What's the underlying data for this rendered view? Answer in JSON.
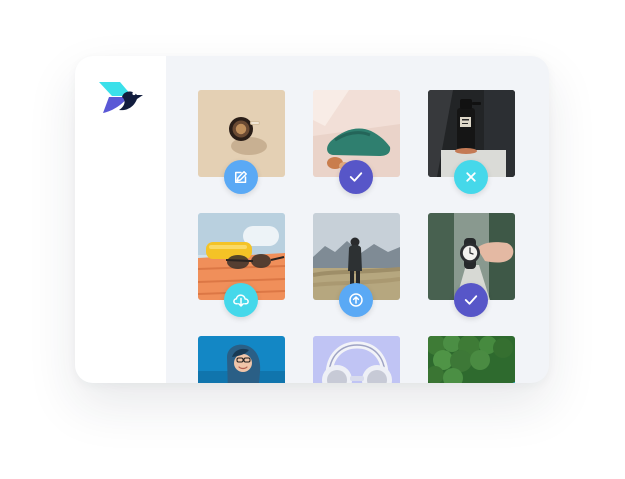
{
  "app": {
    "name": "",
    "logo_icon": "bird-logo-icon"
  },
  "colors": {
    "card_background": "#f2f4f8",
    "sidebar_background": "#ffffff",
    "logo_primary": "#3be0ea",
    "logo_secondary": "#5a58d6",
    "logo_dark": "#121d3e",
    "edit_badge": "#5aa9f5",
    "check_badge": "#5756c8",
    "close_badge": "#45d8ea",
    "download_badge": "#45d8ea",
    "upload_badge": "#5aa9f5"
  },
  "gallery": {
    "images": [
      {
        "subject": "coffee-cup-photo",
        "status": "edit-icon"
      },
      {
        "subject": "green-shoe-photo",
        "status": "check-icon"
      },
      {
        "subject": "spray-bottle-photo",
        "status": "close-icon"
      },
      {
        "subject": "sunglasses-photo",
        "status": "download-cloud-icon"
      },
      {
        "subject": "person-in-field-photo",
        "status": "upload-icon"
      },
      {
        "subject": "wristwatch-photo",
        "status": "check-icon"
      },
      {
        "subject": "smiling-woman-photo",
        "status": "none"
      },
      {
        "subject": "headphones-photo",
        "status": "none"
      },
      {
        "subject": "forest-coast-photo",
        "status": "none"
      }
    ]
  }
}
